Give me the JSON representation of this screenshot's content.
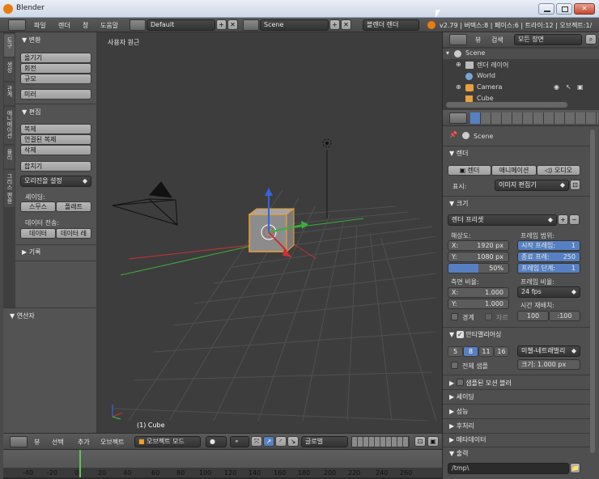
{
  "window": {
    "title": "Blender"
  },
  "topbar": {
    "menus": [
      "파일",
      "렌더",
      "창",
      "도움말"
    ],
    "layout": "Default",
    "scene": "Scene",
    "engine": "블렌더 렌더",
    "stats": "v2.79 | 버텍스:8 | 페이스:6 | 트라이:12 | 오브젝트:1/"
  },
  "tool_tabs": [
    "도구",
    "생성",
    "관계",
    "애니메이션",
    "물리",
    "그리스 펜슬"
  ],
  "toolshelf": {
    "transform_header": "변환",
    "transform_buttons": [
      "옮기기",
      "회전",
      "규모"
    ],
    "mirror": "미러",
    "edit_header": "편집",
    "edit_buttons": [
      "복제",
      "연결된 복제",
      "삭제"
    ],
    "join": "합치기",
    "origin": "오리진을 설정",
    "shading_label": "셰이딩:",
    "smooth": "스무스",
    "flat": "플래트",
    "data_transfer_label": "데이터 전송:",
    "data": "데이터",
    "data_layout": "데이터 레",
    "history": "기록",
    "operator": "연산자"
  },
  "viewport": {
    "view_label": "사용자 원근",
    "object_label": "(1) Cube"
  },
  "viewport_header": {
    "menus": [
      "뷰",
      "선택",
      "추가",
      "오브젝트"
    ],
    "mode": "오브젝트 모드",
    "orientation": "글로벌"
  },
  "timeline": {
    "ticks": [
      "-40",
      "-20",
      "0",
      "20",
      "40",
      "60",
      "80",
      "100",
      "120",
      "140",
      "160",
      "180",
      "200",
      "220",
      "240",
      "260"
    ],
    "current_frame": 1
  },
  "outliner": {
    "view_label": "뷰",
    "search_label": "검색",
    "filter": "모든 장면",
    "items": [
      "Scene",
      "렌더 레이어",
      "World",
      "Camera",
      "Cube"
    ]
  },
  "properties": {
    "breadcrumb": "Scene",
    "render_header": "렌더",
    "render_btn": "렌더",
    "anim_btn": "애니메이션",
    "audio_btn": "오디오",
    "display_label": "표시:",
    "display_value": "이미지 편집기",
    "dimensions_header": "크기",
    "preset": "렌더 프리셋",
    "resolution_label": "해상도:",
    "res_x": "X:",
    "res_x_val": "1920 px",
    "res_y": "Y:",
    "res_y_val": "1080 px",
    "res_pct": "50%",
    "frame_range_label": "프레임 범위:",
    "start_frame": "시작 프레임:",
    "start_val": "1",
    "end_frame": "종료 프레:",
    "end_val": "250",
    "frame_step": "프레임 단계:",
    "step_val": "1",
    "aspect_label": "측면 비율:",
    "asp_x": "X:",
    "asp_x_val": "1.000",
    "asp_y": "Y:",
    "asp_y_val": "1.000",
    "frame_rate_label": "프레임 비율:",
    "fps": "24 fps",
    "border": "경계",
    "crop": "자르",
    "time_remap_label": "시간 재배치:",
    "remap_old": "100",
    "remap_new": ":100",
    "aa_header": "안티앨리어싱",
    "aa_samples": [
      "5",
      "8",
      "11",
      "16"
    ],
    "aa_filter": "미첼-네트래벌리",
    "full_sample": "전체 샘플",
    "filter_size": "크기: 1.000 px",
    "motion_blur": "샘플된 모션 블러",
    "shading": "셰이딩",
    "performance": "성능",
    "post_processing": "후처리",
    "metadata": "메타데이터",
    "output": "출력",
    "output_path": "/tmp\\"
  },
  "colors": {
    "bg_panel": "#4a4a4a",
    "viewport": "#3d3d3d",
    "accent_blue": "#5680c2",
    "axis_x": "#c83232",
    "axis_y": "#3cae3c",
    "axis_z": "#3264dc",
    "selection_orange": "#f0a030"
  }
}
